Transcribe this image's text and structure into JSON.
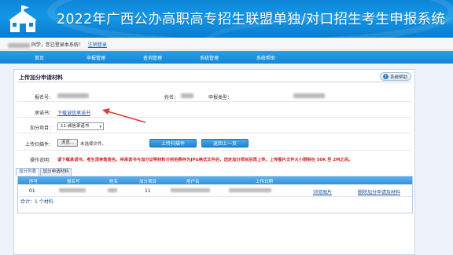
{
  "header": {
    "title": "2022年广西公办高职高专招生联盟单独/对口招生考生申报系统"
  },
  "userbar": {
    "greeting": "同学，您已登录本系统！",
    "logout": "注销登录"
  },
  "nav": {
    "items": [
      "首页",
      "申报管理",
      "查询管理",
      "系统管理",
      "系统帮助"
    ]
  },
  "panel": {
    "title": "上传加分申请材料",
    "help_label": "系统帮助",
    "fields": {
      "regno_label": "报名号：",
      "name_label": "姓名：",
      "type_label": "申报类型：",
      "letter_label": "承诺书：",
      "letter_link": "下载诚信承诺书",
      "item_label": "加分项目：",
      "item_value": "11.诚信承诺书",
      "file_label": "上传扫描件：",
      "file_button": "浏览...",
      "file_status": "未选择文件。",
      "notice_label": "操作说明：",
      "notice_text": "请下载承诺书，考生须亲笔签名。将承诺书与加分证明材料分别拍照存为JPG格式文件后，选定加分项目后再上传。上传图片文件大小限制在 50K 至 2M之间。"
    },
    "buttons": {
      "upload": "上传扫描件",
      "back": "返回上一页"
    },
    "tabs": [
      "加分列表",
      "加分申请材料"
    ],
    "table": {
      "headers": [
        "序号",
        "报名号",
        "姓名",
        "加分项目",
        "用户名",
        "上传日期"
      ],
      "rows": [
        {
          "index": "01",
          "item": "11",
          "view": "浏览图片",
          "delete": "删除加分申请及材料"
        }
      ],
      "total": "合计：1 个材料"
    }
  },
  "colors": {
    "banner": "#1396e6",
    "nav": "#1a8edb",
    "notice": "#d32020",
    "arrow": "#e03a3a"
  }
}
